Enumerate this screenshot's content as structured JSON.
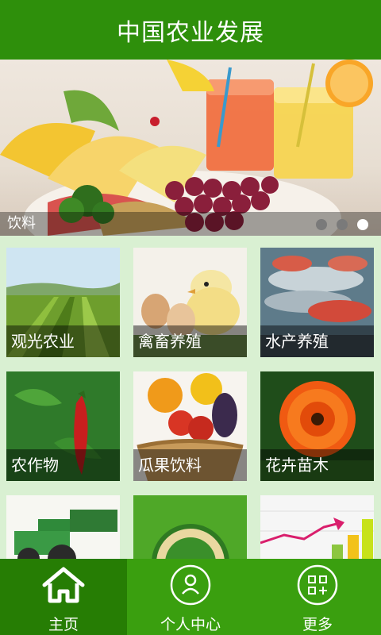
{
  "header": {
    "title": "中国农业发展"
  },
  "banner": {
    "caption": "饮料",
    "dot_count": 3,
    "active_dot": 3
  },
  "grid": {
    "tiles": [
      {
        "label": "观光农业"
      },
      {
        "label": "禽畜养殖"
      },
      {
        "label": "水产养殖"
      },
      {
        "label": "农作物"
      },
      {
        "label": "瓜果饮料"
      },
      {
        "label": "花卉苗木"
      },
      {
        "label": ""
      },
      {
        "label": ""
      },
      {
        "label": ""
      }
    ]
  },
  "tabbar": {
    "items": [
      {
        "label": "主页",
        "icon": "home-icon",
        "active": true
      },
      {
        "label": "个人中心",
        "icon": "person-icon",
        "active": false
      },
      {
        "label": "更多",
        "icon": "grid-plus-icon",
        "active": false
      }
    ]
  },
  "colors": {
    "header_bg": "#2e8f0b",
    "tabbar_bg": "#3a9f0f",
    "tab_active_bg": "#267d04",
    "page_bg": "#d9f0d2"
  }
}
